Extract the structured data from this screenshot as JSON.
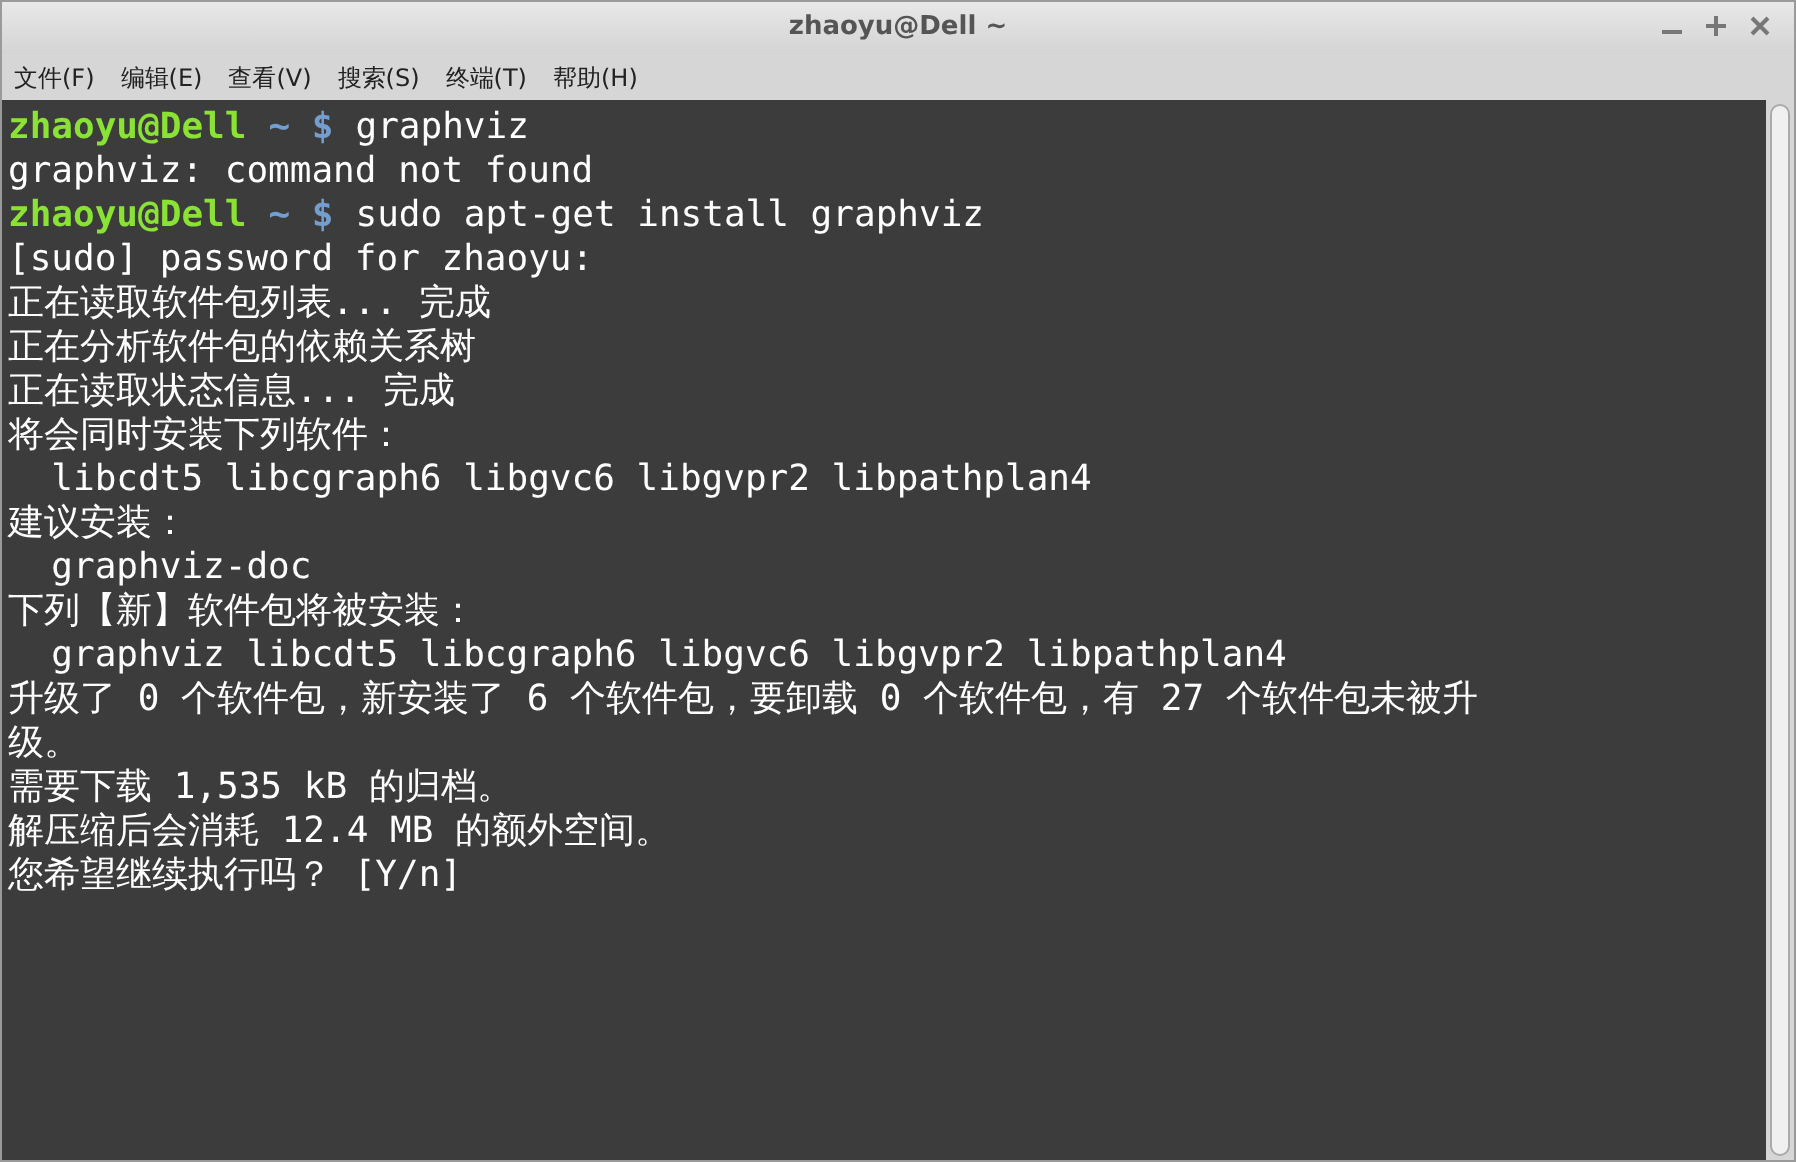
{
  "window": {
    "title": "zhaoyu@Dell ~"
  },
  "menu": [
    "文件(F)",
    "编辑(E)",
    "查看(V)",
    "搜索(S)",
    "终端(T)",
    "帮助(H)"
  ],
  "terminal": {
    "lines": [
      {
        "kind": "prompt",
        "user": "zhaoyu@Dell",
        "path": "~ $",
        "command": "graphviz"
      },
      {
        "kind": "output",
        "text": "graphviz: command not found"
      },
      {
        "kind": "prompt",
        "user": "zhaoyu@Dell",
        "path": "~ $",
        "command": "sudo apt-get install graphviz"
      },
      {
        "kind": "output",
        "text": "[sudo] password for zhaoyu:"
      },
      {
        "kind": "output",
        "text": "正在读取软件包列表... 完成"
      },
      {
        "kind": "output",
        "text": "正在分析软件包的依赖关系树"
      },
      {
        "kind": "output",
        "text": "正在读取状态信息... 完成"
      },
      {
        "kind": "output",
        "text": "将会同时安装下列软件："
      },
      {
        "kind": "output",
        "text": "  libcdt5 libcgraph6 libgvc6 libgvpr2 libpathplan4"
      },
      {
        "kind": "output",
        "text": "建议安装："
      },
      {
        "kind": "output",
        "text": "  graphviz-doc"
      },
      {
        "kind": "output",
        "text": "下列【新】软件包将被安装："
      },
      {
        "kind": "output",
        "text": "  graphviz libcdt5 libcgraph6 libgvc6 libgvpr2 libpathplan4"
      },
      {
        "kind": "output",
        "text": "升级了 0 个软件包，新安装了 6 个软件包，要卸载 0 个软件包，有 27 个软件包未被升"
      },
      {
        "kind": "output",
        "text": "级。"
      },
      {
        "kind": "output",
        "text": "需要下载 1,535 kB 的归档。"
      },
      {
        "kind": "output",
        "text": "解压缩后会消耗 12.4 MB 的额外空间。"
      },
      {
        "kind": "output",
        "text": "您希望继续执行吗？ [Y/n]"
      }
    ]
  }
}
